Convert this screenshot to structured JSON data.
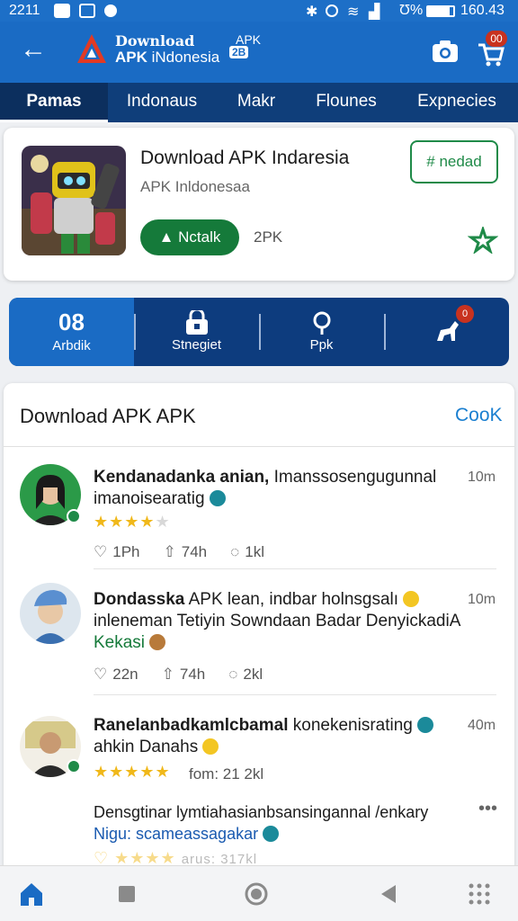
{
  "status_bar": {
    "time": "2211",
    "battery": "Ʊ%",
    "clock": "160.43"
  },
  "app_bar": {
    "brand_line1": "Download",
    "brand_line2_bold": "APK",
    "brand_line2_rest": " iNdonesia",
    "brand_tag": "APK",
    "brand_badge": "2B",
    "cart_badge": "00"
  },
  "tabs": [
    {
      "label": "Pamas"
    },
    {
      "label": "Indonaus"
    },
    {
      "label": "Makr"
    },
    {
      "label": "Flounes"
    },
    {
      "label": "Expnecies"
    }
  ],
  "app_card": {
    "title": "Download APK Indaresia",
    "subtitle": "APK Inldonesaa",
    "install_label": "Nctalk",
    "size": "2PK",
    "tag_label": "# nedad"
  },
  "stats": [
    {
      "value": "08",
      "label": "Arbdik"
    },
    {
      "value": "",
      "label": "Stnegiet"
    },
    {
      "value": "",
      "label": "Ppk"
    },
    {
      "value": "",
      "label": "",
      "badge": "0"
    }
  ],
  "reviews": {
    "heading": "Download APK APK",
    "link": "CooK",
    "items": [
      {
        "name": "Kendanadanka anian,",
        "text1": " Imanssosengugunnal",
        "text2": "imanoisearatig",
        "time": "10m",
        "rating": 4,
        "likes": "1Ph",
        "shares": "74h",
        "comments": "1kl"
      },
      {
        "name": "Dondasska",
        "text1": " APK lean, indbar holnsgsalı",
        "text2": "inleneman Tetiyin Sowndaan Badar DenyickadiA",
        "tag": "Kekasi",
        "time": "10m",
        "likes": "22n",
        "shares": "74h",
        "comments": "2kl"
      },
      {
        "name": "Ranelanbadkamlcbamal",
        "text1": " konekenisrating",
        "text2": "ahkin Danahs",
        "time": "40m",
        "rating": 5,
        "extra": "fom: 21 2kl"
      },
      {
        "text1": "Densgtinar lymtiahasianbsansingannal /enkary",
        "text2": "Nigu: scameassagakar",
        "footer": "arus: 317kl"
      }
    ]
  },
  "colors": {
    "primary": "#1a6bc4",
    "dark": "#0d3c7e",
    "green": "#157a3a",
    "star": "#f0b81a"
  }
}
